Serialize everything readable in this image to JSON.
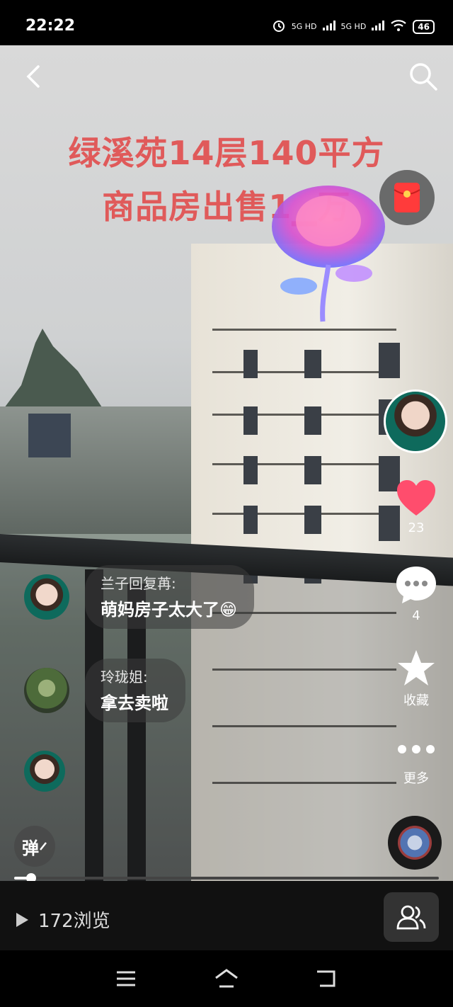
{
  "status_bar": {
    "time": "22:22",
    "signal1": "5G HD",
    "signal2": "5G HD",
    "battery": "46"
  },
  "video": {
    "title_line1": "绿溪苑14层140平方",
    "title_line2": "商品房出售1▁万"
  },
  "sidebar": {
    "like_count": "23",
    "comment_count": "4",
    "favorite_label": "收藏",
    "more_label": "更多"
  },
  "comments": [
    {
      "name": "兰子回复苒:",
      "text": "萌妈房子太大了😁"
    },
    {
      "name": "玲珑姐:",
      "text": "拿去卖啦"
    }
  ],
  "danmu_label": "弹",
  "progress": {
    "fraction": 0.04
  },
  "bottom": {
    "views": "172浏览"
  },
  "colors": {
    "title": "#e05a5a",
    "like": "#ff4d6d"
  }
}
